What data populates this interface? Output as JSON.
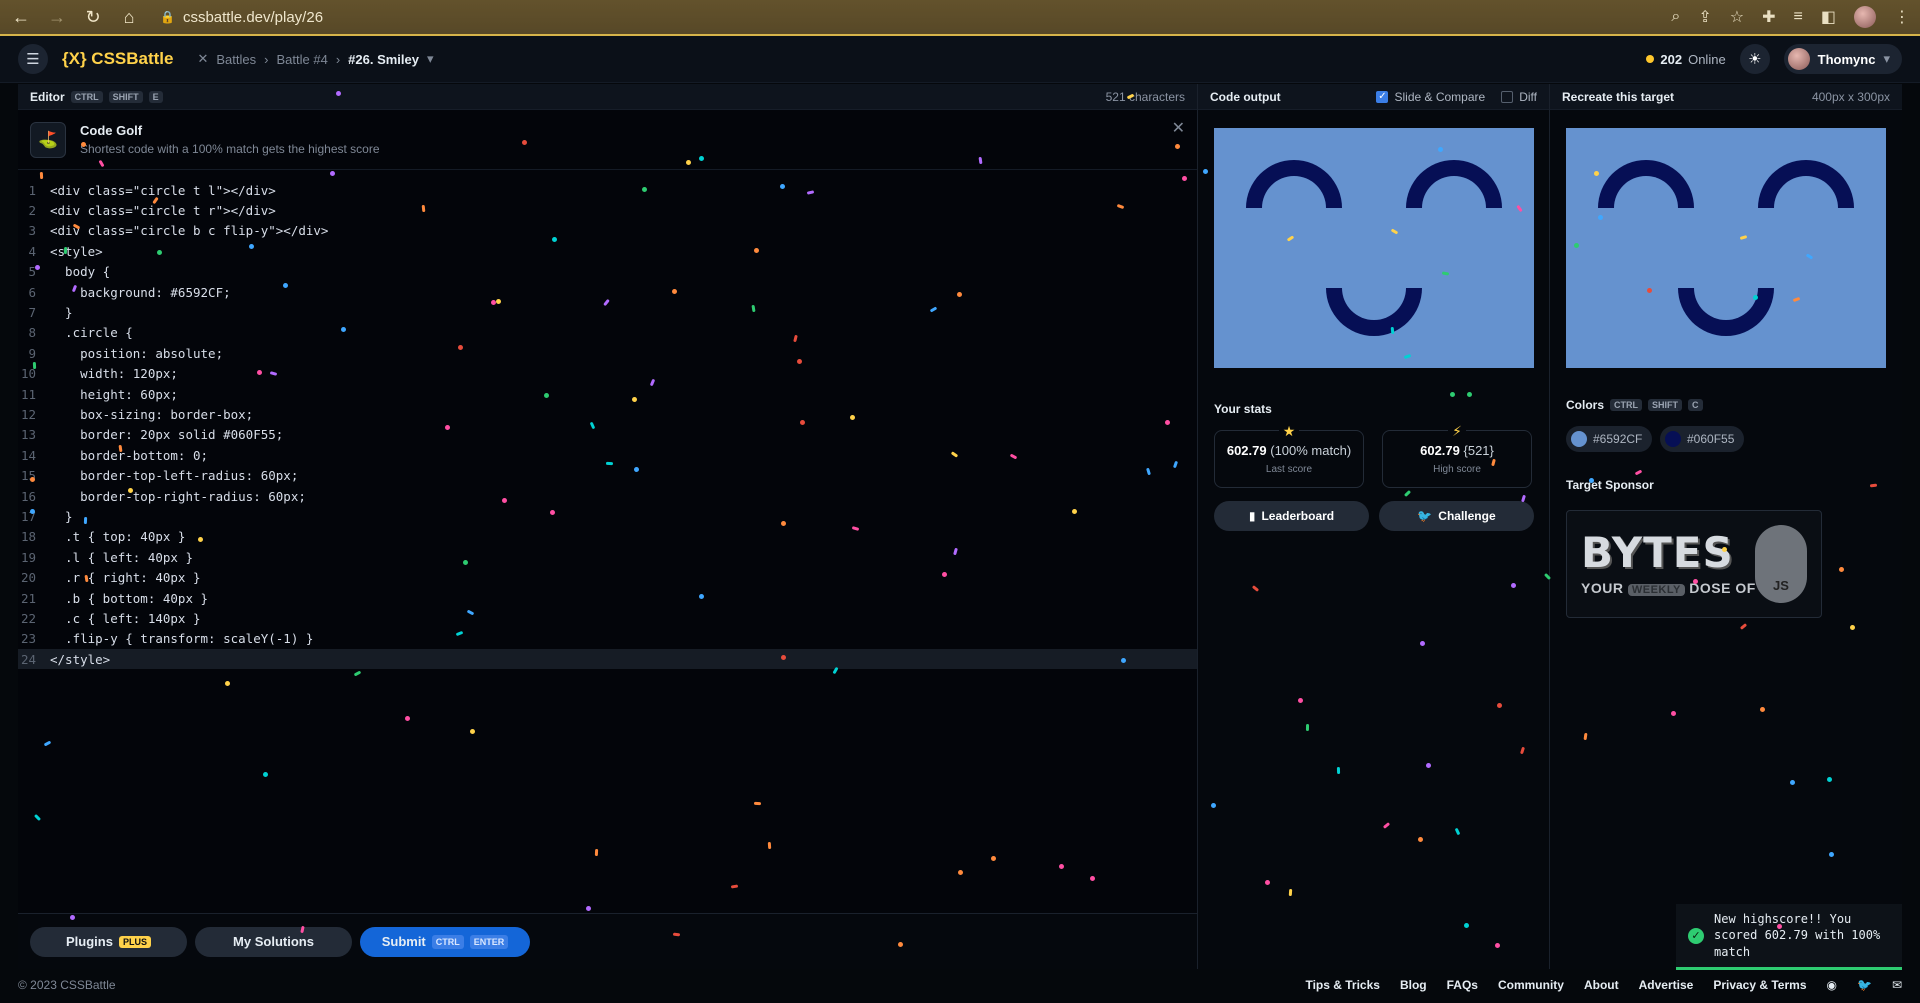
{
  "browser": {
    "url": "cssbattle.dev/play/26",
    "nav_back": "←",
    "nav_forward": "→",
    "nav_reload": "↻",
    "nav_home": "⌂"
  },
  "header": {
    "logo": "{X} CSSBattle",
    "crumb_battles": "Battles",
    "crumb_battle": "Battle #4",
    "crumb_current": "#26. Smiley",
    "online_count": "202",
    "online_label": "Online",
    "user": "Thomync"
  },
  "editor": {
    "title": "Editor",
    "shortcut": [
      "CTRL",
      "SHIFT",
      "E"
    ],
    "char_count": "521 characters",
    "golf_title": "Code Golf",
    "golf_sub": "Shortest code with a 100% match gets the highest score",
    "lines": [
      "<div class=\"circle t l\"></div>",
      "<div class=\"circle t r\"></div>",
      "<div class=\"circle b c flip-y\"></div>",
      "<style>",
      "  body {",
      "    background: #6592CF;",
      "  }",
      "  .circle {",
      "    position: absolute;",
      "    width: 120px;",
      "    height: 60px;",
      "    box-sizing: border-box;",
      "    border: 20px solid #060F55;",
      "    border-bottom: 0;",
      "    border-top-left-radius: 60px;",
      "    border-top-right-radius: 60px;",
      "  }",
      "  .t { top: 40px }",
      "  .l { left: 40px }",
      "  .r { right: 40px }",
      "  .b { bottom: 40px }",
      "  .c { left: 140px }",
      "  .flip-y { transform: scaleY(-1) }",
      "</style>"
    ],
    "plugins_label": "Plugins",
    "plugins_badge": "PLUS",
    "solutions_label": "My Solutions",
    "submit_label": "Submit",
    "submit_keys": [
      "CTRL",
      "ENTER"
    ]
  },
  "output": {
    "title": "Code output",
    "slide_compare": "Slide & Compare",
    "diff": "Diff",
    "stats_title": "Your stats",
    "last_score": "602.79",
    "last_score_detail": "(100% match)",
    "last_score_label": "Last score",
    "high_score": "602.79",
    "high_score_detail": "{521}",
    "high_score_label": "High score",
    "leaderboard": "Leaderboard",
    "challenge": "Challenge"
  },
  "target": {
    "title": "Recreate this target",
    "size": "400px x 300px",
    "colors_title": "Colors",
    "colors_keys": [
      "CTRL",
      "SHIFT",
      "C"
    ],
    "colors": [
      {
        "hex": "#6592CF",
        "label": "#6592CF"
      },
      {
        "hex": "#060F55",
        "label": "#060F55"
      }
    ],
    "sponsor_title": "Target Sponsor",
    "sponsor_big": "BYTES",
    "sponsor_your": "YOUR",
    "sponsor_weekly": "WEEKLY",
    "sponsor_dose": "DOSE OF",
    "sponsor_js": "JS"
  },
  "footer": {
    "copyright": "© 2023 CSSBattle",
    "links": [
      "Tips & Tricks",
      "Blog",
      "FAQs",
      "Community",
      "About",
      "Advertise",
      "Privacy & Terms"
    ]
  },
  "toast": {
    "message": "New highscore!! You scored 602.79 with 100% match"
  },
  "colors": {
    "bg_target": "#6592CF",
    "fg_target": "#060F55",
    "accent": "#ffd24a",
    "submit": "#1466d8",
    "success": "#2ecc71"
  }
}
